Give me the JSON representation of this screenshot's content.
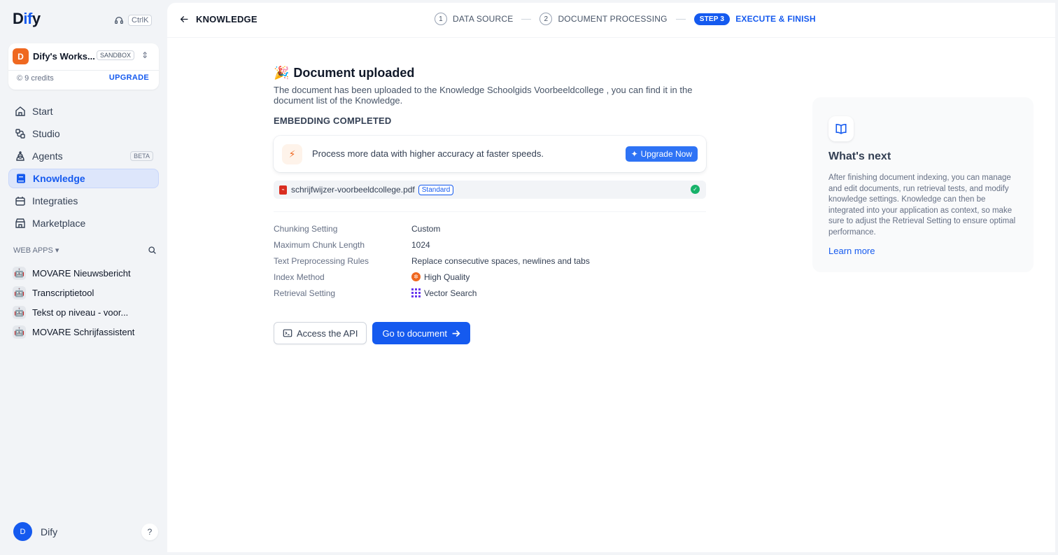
{
  "sidebar": {
    "logo": {
      "prefix": "D",
      "accent": "if",
      "suffix": "y"
    },
    "shortcut": "CtrlK",
    "workspace": {
      "avatar": "D",
      "name": "Dify's Works...",
      "plan": "SANDBOX",
      "credits": "9 credits",
      "upgrade": "UPGRADE"
    },
    "nav": [
      {
        "label": "Start",
        "icon": "home-icon"
      },
      {
        "label": "Studio",
        "icon": "studio-icon"
      },
      {
        "label": "Agents",
        "icon": "agent-icon",
        "badge": "BETA"
      },
      {
        "label": "Knowledge",
        "icon": "knowledge-icon",
        "active": true
      },
      {
        "label": "Integraties",
        "icon": "integrations-icon"
      },
      {
        "label": "Marketplace",
        "icon": "marketplace-icon"
      }
    ],
    "web_apps_label": "WEB APPS",
    "web_apps": [
      {
        "label": "MOVARE Nieuwsbericht"
      },
      {
        "label": "Transcriptietool"
      },
      {
        "label": "Tekst op niveau - voor..."
      },
      {
        "label": "MOVARE Schrijfassistent"
      }
    ],
    "user": {
      "avatar": "D",
      "name": "Dify"
    },
    "help": "?"
  },
  "header": {
    "back_label": "KNOWLEDGE",
    "steps": [
      {
        "num": "1",
        "label": "DATA SOURCE"
      },
      {
        "num": "2",
        "label": "DOCUMENT PROCESSING"
      },
      {
        "num": "STEP 3",
        "label": "EXECUTE & FINISH",
        "active": true
      }
    ]
  },
  "main": {
    "title_emoji": "🎉",
    "title": "Document uploaded",
    "description": "The document has been uploaded to the Knowledge Schoolgids Voorbeeldcollege , you can find it in the document list of the Knowledge.",
    "status": "EMBEDDING COMPLETED",
    "upgrade_card": {
      "text": "Process more data with higher accuracy at faster speeds.",
      "button": "Upgrade Now"
    },
    "file": {
      "name": "schrijfwijzer-voorbeeldcollege.pdf",
      "badge": "Standard"
    },
    "settings": [
      {
        "label": "Chunking Setting",
        "value": "Custom"
      },
      {
        "label": "Maximum Chunk Length",
        "value": "1024"
      },
      {
        "label": "Text Preprocessing Rules",
        "value": "Replace consecutive spaces, newlines and tabs"
      },
      {
        "label": "Index Method",
        "value": "High Quality"
      },
      {
        "label": "Retrieval Setting",
        "value": "Vector Search"
      }
    ],
    "buttons": {
      "api": "Access the API",
      "go": "Go to document"
    }
  },
  "whats_next": {
    "title": "What's next",
    "text": "After finishing document indexing, you can manage and edit documents, run retrieval tests, and modify knowledge settings. Knowledge can then be integrated into your application as context, so make sure to adjust the Retrieval Setting to ensure optimal performance.",
    "link": "Learn more"
  },
  "colors": {
    "accent": "#155aef",
    "success": "#17b26a",
    "warning": "#ef6820"
  }
}
